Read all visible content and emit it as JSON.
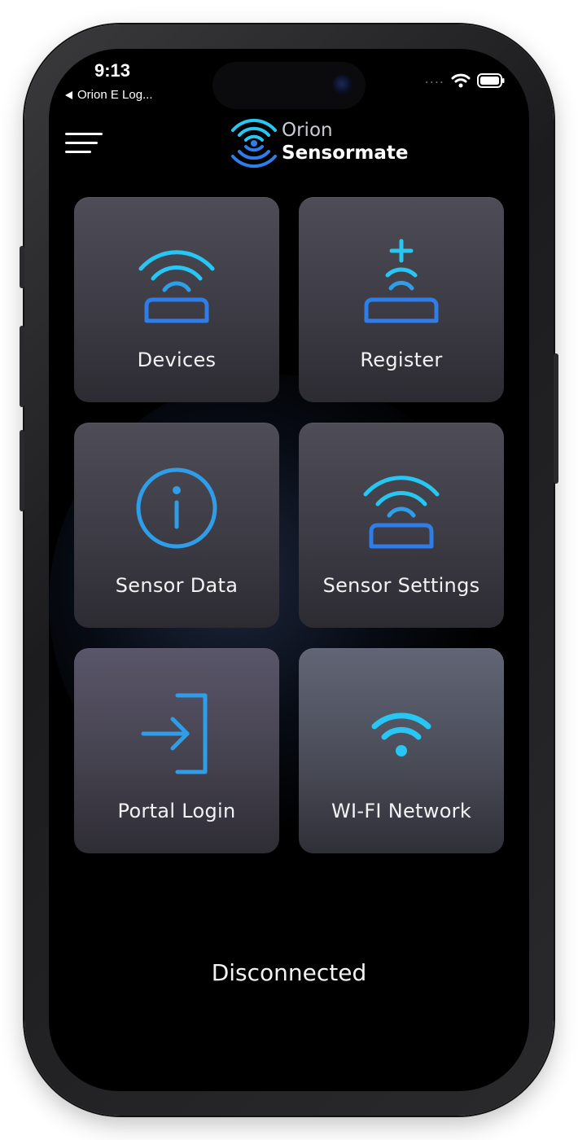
{
  "status_bar": {
    "time": "9:13",
    "back_app": "Orion E Log...",
    "signal_dots": "....",
    "icons": [
      "back-arrow-icon",
      "cellular-dots-icon",
      "wifi-icon",
      "battery-icon"
    ]
  },
  "header": {
    "menu_icon": "hamburger-menu-icon",
    "logo_line1": "Orion",
    "logo_line2": "Sensormate"
  },
  "tiles": [
    {
      "label": "Devices",
      "icon": "sensor-wireless-icon"
    },
    {
      "label": "Register",
      "icon": "sensor-add-icon"
    },
    {
      "label": "Sensor Data",
      "icon": "info-circle-icon"
    },
    {
      "label": "Sensor Settings",
      "icon": "sensor-wireless-icon"
    },
    {
      "label": "Portal Login",
      "icon": "login-arrow-icon"
    },
    {
      "label": "WI-FI Network",
      "icon": "wifi-icon"
    }
  ],
  "connection_status": "Disconnected",
  "colors": {
    "accent_cyan": "#27c6f3",
    "accent_blue": "#2f7de8",
    "tile_top": "#4e4d57",
    "tile_bottom": "#2c2b32",
    "background": "#000000",
    "text": "#f2f2f4"
  }
}
